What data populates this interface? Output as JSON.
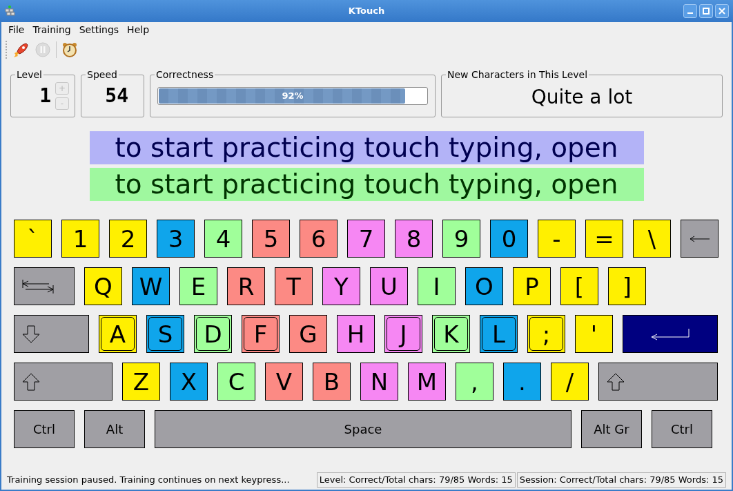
{
  "window": {
    "title": "KTouch"
  },
  "menu": [
    {
      "label": "File"
    },
    {
      "label": "Training"
    },
    {
      "label": "Settings"
    },
    {
      "label": "Help"
    }
  ],
  "toolbar": [
    {
      "kind": "rocket",
      "disabled": false
    },
    {
      "kind": "pause",
      "disabled": true
    },
    {
      "kind": "separator"
    },
    {
      "kind": "clock",
      "disabled": false
    }
  ],
  "level": {
    "label": "Level",
    "value": "1",
    "plus": "+",
    "minus": "-",
    "buttons_disabled": true
  },
  "speed": {
    "label": "Speed",
    "value": "54"
  },
  "correctness": {
    "label": "Correctness",
    "level": 0.92,
    "text": "92%"
  },
  "new_characters": {
    "label": "New Characters in This Level",
    "value": "Quite a lot"
  },
  "teacher_line": "to start practicing touch typing, open",
  "student_line": "to start practicing touch typing, open",
  "keyboard": [
    [
      {
        "kind": "char",
        "label": "`",
        "color": "#fff000",
        "home": false
      },
      {
        "kind": "char",
        "label": "1",
        "color": "#fff000",
        "home": false
      },
      {
        "kind": "char",
        "label": "2",
        "color": "#fff000",
        "home": false
      },
      {
        "kind": "char",
        "label": "3",
        "color": "#0fa5eb",
        "home": false
      },
      {
        "kind": "char",
        "label": "4",
        "color": "#a0ff9a",
        "home": false
      },
      {
        "kind": "char",
        "label": "5",
        "color": "#fc8a84",
        "home": false
      },
      {
        "kind": "char",
        "label": "6",
        "color": "#fc8a84",
        "home": false
      },
      {
        "kind": "char",
        "label": "7",
        "color": "#f687f3",
        "home": false
      },
      {
        "kind": "char",
        "label": "8",
        "color": "#f687f3",
        "home": false
      },
      {
        "kind": "char",
        "label": "9",
        "color": "#a0ff9a",
        "home": false
      },
      {
        "kind": "char",
        "label": "0",
        "color": "#0fa5eb",
        "home": false
      },
      {
        "kind": "char",
        "label": "-",
        "color": "#fff000",
        "home": false
      },
      {
        "kind": "char",
        "label": "=",
        "color": "#fff000",
        "home": false
      },
      {
        "kind": "char",
        "label": "\\",
        "color": "#fff000",
        "home": false
      },
      {
        "kind": "backspace",
        "color": "#a09fa4"
      }
    ],
    [
      {
        "kind": "tab",
        "color": "#a09fa4"
      },
      {
        "kind": "char",
        "label": "Q",
        "color": "#fff000",
        "home": false
      },
      {
        "kind": "char",
        "label": "W",
        "color": "#0fa5eb",
        "home": false
      },
      {
        "kind": "char",
        "label": "E",
        "color": "#a0ff9a",
        "home": false
      },
      {
        "kind": "char",
        "label": "R",
        "color": "#fc8a84",
        "home": false
      },
      {
        "kind": "char",
        "label": "T",
        "color": "#fc8a84",
        "home": false
      },
      {
        "kind": "char",
        "label": "Y",
        "color": "#f687f3",
        "home": false
      },
      {
        "kind": "char",
        "label": "U",
        "color": "#f687f3",
        "home": false
      },
      {
        "kind": "char",
        "label": "I",
        "color": "#a0ff9a",
        "home": false
      },
      {
        "kind": "char",
        "label": "O",
        "color": "#0fa5eb",
        "home": false
      },
      {
        "kind": "char",
        "label": "P",
        "color": "#fff000",
        "home": false
      },
      {
        "kind": "char",
        "label": "[",
        "color": "#fff000",
        "home": false
      },
      {
        "kind": "char",
        "label": "]",
        "color": "#fff000",
        "home": false
      }
    ],
    [
      {
        "kind": "caps",
        "color": "#a09fa4"
      },
      {
        "kind": "char",
        "label": "A",
        "color": "#fff000",
        "home": true
      },
      {
        "kind": "char",
        "label": "S",
        "color": "#0fa5eb",
        "home": true
      },
      {
        "kind": "char",
        "label": "D",
        "color": "#a0ff9a",
        "home": true
      },
      {
        "kind": "char",
        "label": "F",
        "color": "#fc8a84",
        "home": true
      },
      {
        "kind": "char",
        "label": "G",
        "color": "#fc8a84",
        "home": false
      },
      {
        "kind": "char",
        "label": "H",
        "color": "#f687f3",
        "home": false
      },
      {
        "kind": "char",
        "label": "J",
        "color": "#f687f3",
        "home": true
      },
      {
        "kind": "char",
        "label": "K",
        "color": "#a0ff9a",
        "home": true
      },
      {
        "kind": "char",
        "label": "L",
        "color": "#0fa5eb",
        "home": true
      },
      {
        "kind": "char",
        "label": ";",
        "color": "#fff000",
        "home": true
      },
      {
        "kind": "char",
        "label": "'",
        "color": "#fff000",
        "home": false
      },
      {
        "kind": "enter",
        "color": "#000080"
      }
    ],
    [
      {
        "kind": "shift",
        "color": "#a09fa4"
      },
      {
        "kind": "char",
        "label": "Z",
        "color": "#fff000",
        "home": false
      },
      {
        "kind": "char",
        "label": "X",
        "color": "#0fa5eb",
        "home": false
      },
      {
        "kind": "char",
        "label": "C",
        "color": "#a0ff9a",
        "home": false
      },
      {
        "kind": "char",
        "label": "V",
        "color": "#fc8a84",
        "home": false
      },
      {
        "kind": "char",
        "label": "B",
        "color": "#fc8a84",
        "home": false
      },
      {
        "kind": "char",
        "label": "N",
        "color": "#f687f3",
        "home": false
      },
      {
        "kind": "char",
        "label": "M",
        "color": "#f687f3",
        "home": false
      },
      {
        "kind": "char",
        "label": ",",
        "color": "#a0ff9a",
        "home": false
      },
      {
        "kind": "char",
        "label": ".",
        "color": "#0fa5eb",
        "home": false
      },
      {
        "kind": "char",
        "label": "/",
        "color": "#fff000",
        "home": false
      },
      {
        "kind": "shift",
        "color": "#a09fa4"
      }
    ],
    [
      {
        "kind": "modifier",
        "label": "Ctrl",
        "color": "#a09fa4"
      },
      {
        "kind": "modifier",
        "label": "Alt",
        "color": "#a09fa4"
      },
      {
        "kind": "space",
        "label": "Space",
        "color": "#a09fa4"
      },
      {
        "kind": "modifier",
        "label": "Alt Gr",
        "color": "#a09fa4"
      },
      {
        "kind": "modifier",
        "label": "Ctrl",
        "color": "#a09fa4"
      }
    ]
  ],
  "status_bar": {
    "message": "Training session paused. Training continues on next keypress...",
    "level_stats": "Level:  Correct/Total chars: 79/85  Words: 15",
    "session_stats": "Session: Correct/Total chars: 79/85  Words: 15"
  }
}
